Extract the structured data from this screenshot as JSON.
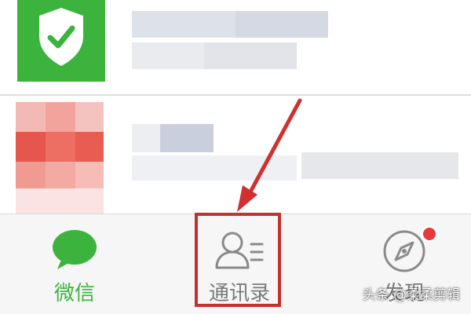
{
  "tabs": [
    {
      "label": "微信",
      "icon": "chat-bubble-icon"
    },
    {
      "label": "通讯录",
      "icon": "contacts-icon"
    },
    {
      "label": "发现",
      "icon": "compass-icon"
    }
  ],
  "colors": {
    "accent_green": "#3cb33d",
    "highlight_red": "#c8302f",
    "badge_red": "#e8393b",
    "inactive_gray": "#7a7a7a"
  },
  "watermark": "头条 @柔柔剪辑"
}
